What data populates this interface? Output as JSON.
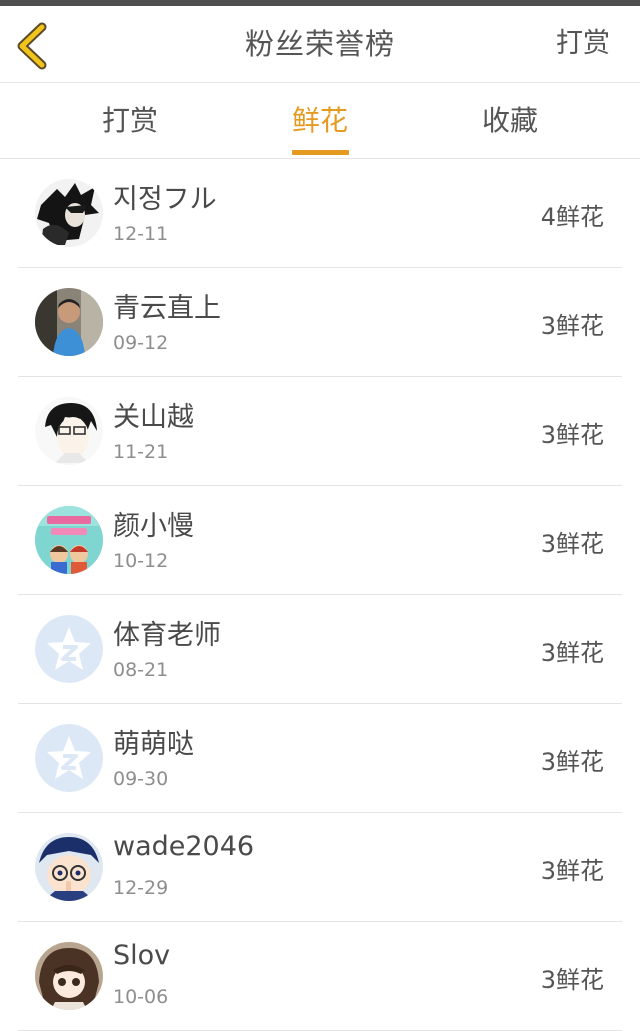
{
  "header": {
    "title": "粉丝荣誉榜",
    "action_label": "打赏"
  },
  "tabs": [
    {
      "label": "打赏",
      "active": false
    },
    {
      "label": "鲜花",
      "active": true
    },
    {
      "label": "收藏",
      "active": false
    }
  ],
  "colors": {
    "accent": "#e59b22",
    "text": "#4a4a4a",
    "muted": "#8e8e8e"
  },
  "fans": [
    {
      "name": "지정フル",
      "date": "12-11",
      "count": "4鲜花",
      "avatar": "dark-anime-boy-avatar"
    },
    {
      "name": "青云直上",
      "date": "09-12",
      "count": "3鲜花",
      "avatar": "child-photo-avatar"
    },
    {
      "name": "关山越",
      "date": "11-21",
      "count": "3鲜花",
      "avatar": "glasses-anime-avatar"
    },
    {
      "name": "颜小慢",
      "date": "10-12",
      "count": "3鲜花",
      "avatar": "book-cover-avatar"
    },
    {
      "name": "体育老师",
      "date": "08-21",
      "count": "3鲜花",
      "avatar": "default-star-avatar"
    },
    {
      "name": "萌萌哒",
      "date": "09-30",
      "count": "3鲜花",
      "avatar": "default-star-avatar"
    },
    {
      "name": "wade2046",
      "date": "12-29",
      "count": "3鲜花",
      "avatar": "detective-anime-avatar"
    },
    {
      "name": "Slov",
      "date": "10-06",
      "count": "3鲜花",
      "avatar": "chibi-girl-avatar"
    }
  ]
}
